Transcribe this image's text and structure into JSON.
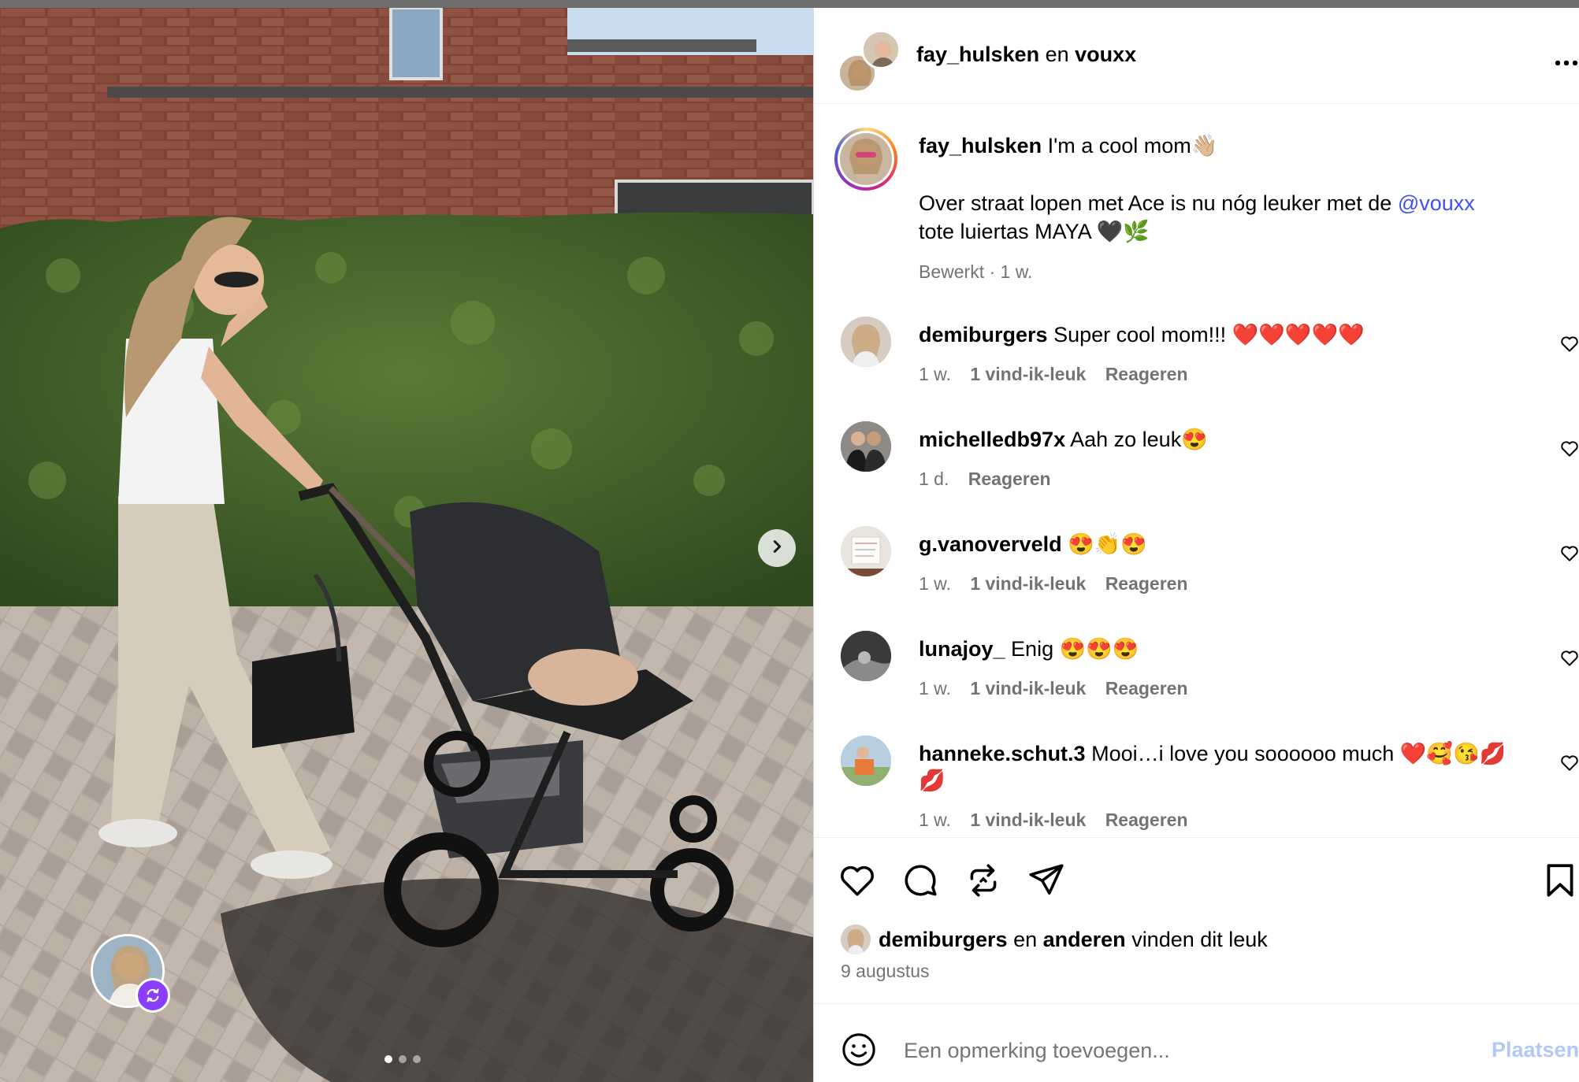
{
  "post": {
    "header": {
      "author": "fay_hulsken",
      "conjunction": "en",
      "coauthor": "vouxx",
      "more_icon": "more-horizontal-icon"
    },
    "caption": {
      "username": "fay_hulsken",
      "line1": "I'm a cool mom👋🏼",
      "line2_pre": "Over straat lopen met Ace is nu nóg leuker met de",
      "mention": "@vouxx",
      "line3": "tote luiertas MAYA 🖤🌿",
      "meta": "Bewerkt · 1 w."
    },
    "comments": [
      {
        "username": "demiburgers",
        "text": "Super cool mom!!! ❤️❤️❤️❤️❤️",
        "time": "1 w.",
        "likes": "1 vind-ik-leuk",
        "reply": "Reageren"
      },
      {
        "username": "michelledb97x",
        "text": "Aah zo leuk😍",
        "time": "1 d.",
        "likes": "",
        "reply": "Reageren"
      },
      {
        "username": "g.vanoverveld",
        "text": "😍👏😍",
        "time": "1 w.",
        "likes": "1 vind-ik-leuk",
        "reply": "Reageren"
      },
      {
        "username": "lunajoy_",
        "text": "Enig 😍😍😍",
        "time": "1 w.",
        "likes": "1 vind-ik-leuk",
        "reply": "Reageren"
      },
      {
        "username": "hanneke.schut.3",
        "text": "Mooi…i love you soooooo much ❤️🥰😘💋",
        "text_cont": "💋",
        "time": "1 w.",
        "likes": "1 vind-ik-leuk",
        "reply": "Reageren"
      }
    ],
    "likes_line": {
      "user": "demiburgers",
      "en": "en",
      "others": "anderen",
      "suffix": "vinden dit leuk"
    },
    "date": "9 augustus",
    "comment_input": {
      "placeholder": "Een opmerking toevoegen...",
      "post_label": "Plaatsen"
    }
  },
  "icons": {
    "like": "heart-icon",
    "comment": "comment-icon",
    "repost": "repost-icon",
    "share": "send-icon",
    "save": "bookmark-icon",
    "emoji": "emoji-icon",
    "next": "chevron-right-icon"
  },
  "colors": {
    "link": "#4150f7",
    "muted": "#737373",
    "post_disabled": "#b2c9f7",
    "collab_badge": "#8a3ffc"
  }
}
